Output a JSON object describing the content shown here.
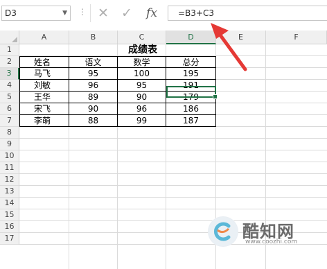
{
  "formula_bar": {
    "name_box": "D3",
    "cancel_icon": "✕",
    "enter_icon": "✓",
    "fx_label": "fx",
    "formula": "=B3+C3"
  },
  "columns": [
    "A",
    "B",
    "C",
    "D",
    "E",
    "F"
  ],
  "rows": [
    "1",
    "2",
    "3",
    "4",
    "5",
    "6",
    "7",
    "8",
    "9",
    "10",
    "11",
    "12",
    "13",
    "14",
    "15",
    "16",
    "17"
  ],
  "selected_cell": "D3",
  "sheet": {
    "title": "成绩表",
    "headers": [
      "姓名",
      "语文",
      "数学",
      "总分"
    ],
    "data": [
      [
        "马飞",
        "95",
        "100",
        "195"
      ],
      [
        "刘敏",
        "96",
        "95",
        "191"
      ],
      [
        "王华",
        "89",
        "90",
        "179"
      ],
      [
        "宋飞",
        "90",
        "96",
        "186"
      ],
      [
        "李萌",
        "88",
        "99",
        "187"
      ]
    ]
  },
  "watermark": {
    "logo_icon": "coozhi-logo-icon",
    "title": "酷知网",
    "url": "www.coozhi.com"
  },
  "colors": {
    "accent": "#217346",
    "arrow": "#e53935"
  }
}
